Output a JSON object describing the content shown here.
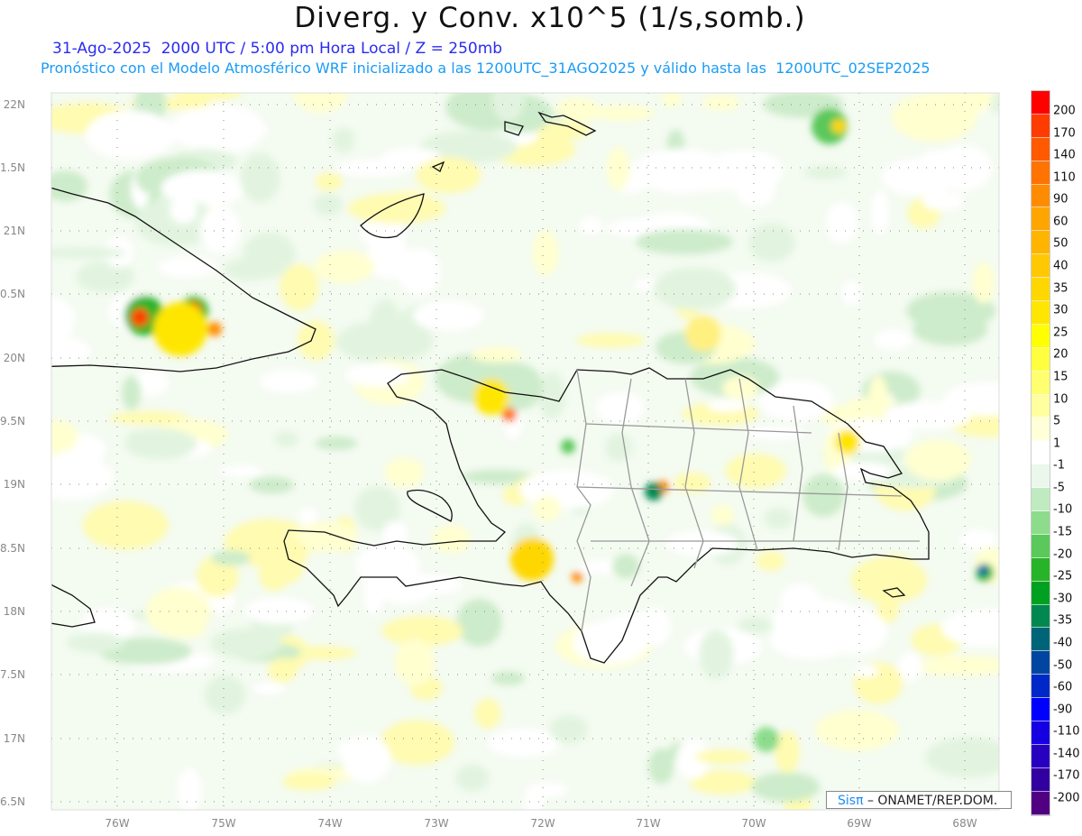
{
  "title": "Diverg. y Conv. x10^5 (1/s,somb.)",
  "subtitle": "31-Ago-2025  2000 UTC / 5:00 pm Hora Local / Z = 250mb",
  "forecast_note": "Pronóstico con el Modelo Atmosférico WRF inicializado a las 1200UTC_31AGO2025 y válido hasta las  1200UTC_02SEP2025",
  "lon_labels": [
    "76W",
    "75W",
    "74W",
    "73W",
    "72W",
    "71W",
    "70W",
    "69W",
    "68W"
  ],
  "lat_labels": [
    "22N",
    "1.5N",
    "21N",
    "0.5N",
    "20N",
    "9.5N",
    "19N",
    "8.5N",
    "18N",
    "7.5N",
    "17N",
    "6.5N"
  ],
  "colorbar": {
    "labels": [
      "200",
      "170",
      "140",
      "110",
      "90",
      "60",
      "50",
      "40",
      "35",
      "30",
      "25",
      "20",
      "15",
      "10",
      "5",
      "1",
      "-1",
      "-5",
      "-10",
      "-15",
      "-20",
      "-25",
      "-30",
      "-35",
      "-40",
      "-50",
      "-60",
      "-90",
      "-110",
      "-140",
      "-170",
      "-200"
    ],
    "colors": [
      "#ff0000",
      "#ff1e00",
      "#ff3c00",
      "#ff5a00",
      "#ff7300",
      "#ff8c00",
      "#ffa500",
      "#ffb400",
      "#ffc800",
      "#ffd700",
      "#ffe600",
      "#ffff00",
      "#ffff40",
      "#ffff70",
      "#ffffa0",
      "#ffffd8",
      "#ffffff",
      "#eaf7ea",
      "#c0ebc0",
      "#8cdc8c",
      "#5ac85a",
      "#28b428",
      "#00a020",
      "#008850",
      "#006478",
      "#0046a0",
      "#0028c8",
      "#0000ff",
      "#1400e0",
      "#2800c0",
      "#3200a0",
      "#500080"
    ]
  },
  "logo": {
    "brand": "Sisπ",
    "text": "– ONAMET/REP.DOM."
  }
}
